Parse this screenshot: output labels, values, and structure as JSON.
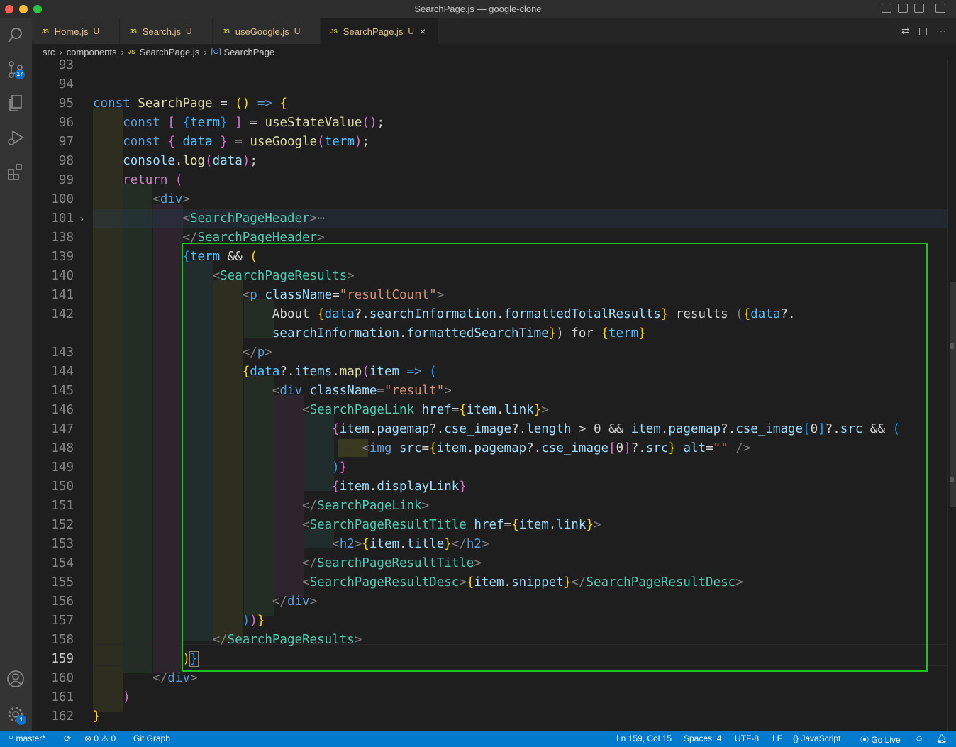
{
  "window": {
    "title": "SearchPage.js — google-clone"
  },
  "activity": {
    "scm_badge": "17",
    "settings_badge": "1"
  },
  "tabs": [
    {
      "icon": "JS",
      "name": "Home.js",
      "status": "U"
    },
    {
      "icon": "JS",
      "name": "Search.js",
      "status": "U"
    },
    {
      "icon": "JS",
      "name": "useGoogle.js",
      "status": "U"
    },
    {
      "icon": "JS",
      "name": "SearchPage.js",
      "status": "U",
      "close": "×"
    }
  ],
  "breadcrumb": {
    "items": [
      "src",
      "components",
      "SearchPage.js",
      "SearchPage"
    ],
    "file_icon": "JS",
    "symbol_icon": "[⊙]"
  },
  "editor": {
    "line_numbers": [
      "93",
      "94",
      "95",
      "96",
      "97",
      "98",
      "99",
      "100",
      "101",
      "138",
      "139",
      "140",
      "141",
      "142",
      "",
      "143",
      "144",
      "145",
      "146",
      "147",
      "148",
      "149",
      "150",
      "151",
      "152",
      "153",
      "154",
      "155",
      "156",
      "157",
      "158",
      "159",
      "160",
      "161",
      "162"
    ],
    "current_line": "159",
    "fold_marker": "›"
  },
  "status": {
    "branch": "master*",
    "errors": "0",
    "warnings": "0",
    "git_graph": "Git Graph",
    "position": "Ln 159, Col 15",
    "spaces": "Spaces: 4",
    "encoding": "UTF-8",
    "eol": "LF",
    "language": "JavaScript",
    "golive": "Go Live"
  },
  "colors": {
    "statusbar": "#007acc",
    "highlight_box": "#1ec21e",
    "keyword": "#569cd6",
    "tag": "#4ec9b0",
    "string": "#ce9178",
    "variable": "#9cdcfe",
    "function": "#dcdcaa"
  }
}
